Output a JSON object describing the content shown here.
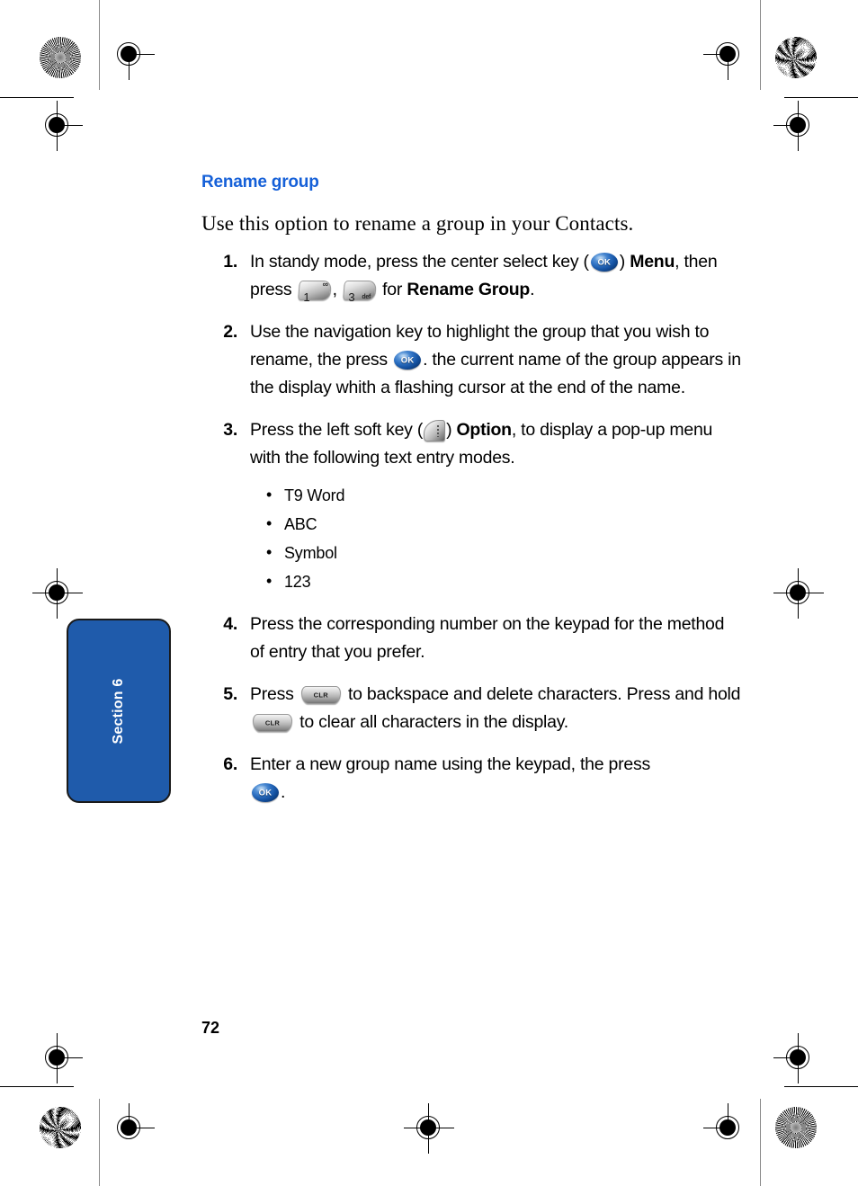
{
  "page": {
    "number": "72",
    "section_tab_label": "Section 6",
    "heading": "Rename group",
    "intro": "Use this option to rename a group in your Contacts.",
    "heading_color": "#1560d8",
    "tab_color": "#1f5bab"
  },
  "steps": [
    {
      "num": "1.",
      "part1": "In standy mode, press the center select key (",
      "part2": ")",
      "part3": "Menu",
      "part4": ", then press",
      "part5": ",",
      "part6": "for",
      "part7": "Rename Group",
      "part8": "."
    },
    {
      "num": "2.",
      "part1": "Use the navigation key to highlight the group that you wish to rename, the press",
      "part2": ". the current name of the group appears in the display whith a flashing cursor at the end of the name."
    },
    {
      "num": "3.",
      "part1": "Press the left soft key (",
      "part2": ")",
      "part3": "Option",
      "part4": ", to display a pop-up menu with the following text entry modes."
    },
    {
      "num": "4.",
      "part1": "Press the corresponding number on the keypad for the method of entry that you prefer."
    },
    {
      "num": "5.",
      "part1": "Press",
      "part2": "to backspace and delete characters. Press and hold",
      "part3": "to clear all characters in the display."
    },
    {
      "num": "6.",
      "part1": "Enter a new group name using the keypad, the press",
      "part2": "."
    }
  ],
  "text_entry_modes": [
    {
      "label": "T9 Word"
    },
    {
      "label": "ABC"
    },
    {
      "label": "Symbol"
    },
    {
      "label": "123"
    }
  ],
  "keys": {
    "ok_label": "OK",
    "clr_label": "CLR",
    "key1_digit": "1",
    "key1_sub": "∞",
    "key3_digit": "3",
    "key3_sub": "def"
  }
}
